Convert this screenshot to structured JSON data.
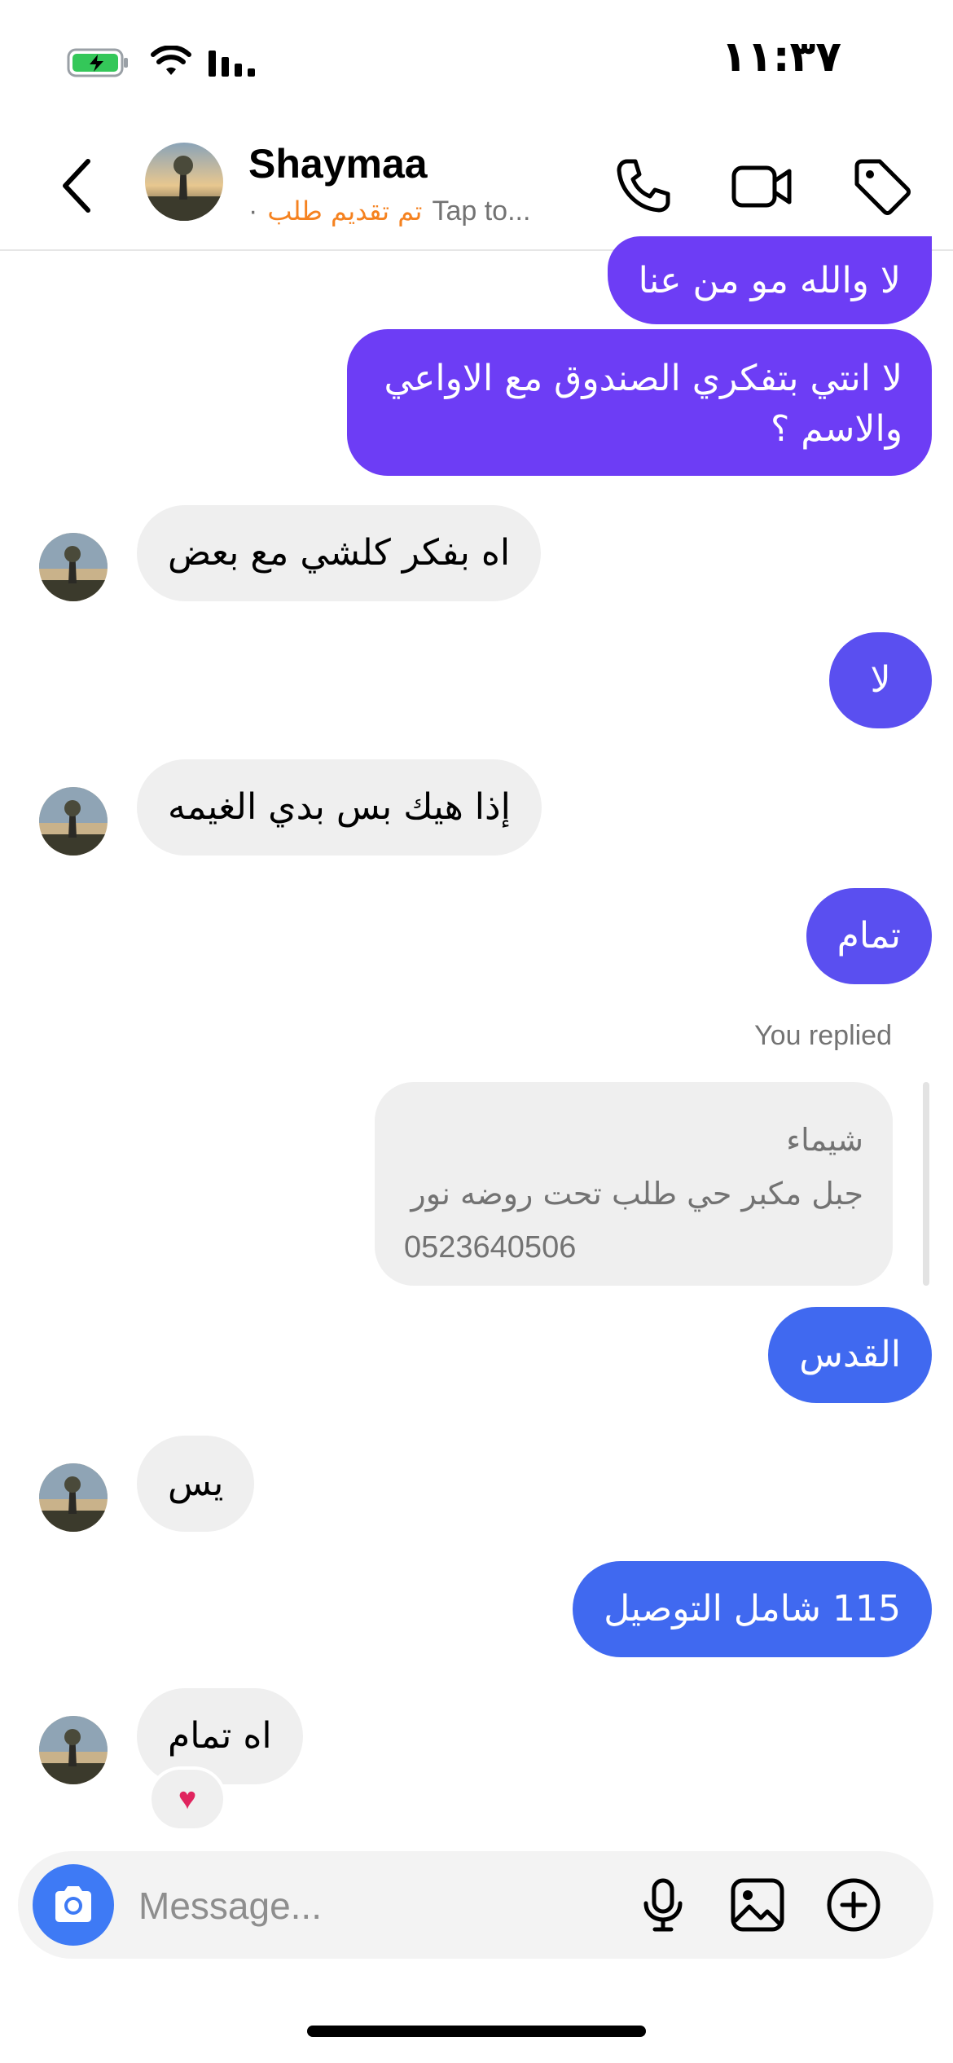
{
  "status_bar": {
    "time": "١١:٣٧",
    "battery_level": 0.85
  },
  "header": {
    "contact_name": "Shaymaa",
    "subtitle_separator": "·",
    "subtitle_order": "تم تقديم طلب",
    "subtitle_hint": "Tap to..."
  },
  "messages": [
    {
      "side": "out",
      "text": "لا والله مو من عنا"
    },
    {
      "side": "out",
      "text": "لا انتي بتفكري الصندوق مع الاواعي",
      "text2": "والاسم ؟"
    },
    {
      "side": "in",
      "text": "اه بفكر كلشي مع بعض"
    },
    {
      "side": "out",
      "text": "لا"
    },
    {
      "side": "in",
      "text": "إذا هيك بس بدي الغيمه"
    },
    {
      "side": "out",
      "text": "تمام"
    },
    {
      "side": "out",
      "text": "القدس"
    },
    {
      "side": "in",
      "text": "يس"
    },
    {
      "side": "out",
      "text": "115 شامل التوصيل"
    },
    {
      "side": "in",
      "text": "اه تمام",
      "reaction": "♥"
    }
  ],
  "reply": {
    "label": "You replied",
    "line1": "شيماء",
    "line2": "جبل مكبر حي طلب تحت روضه نور",
    "line3": "0523640506"
  },
  "composer": {
    "placeholder": "Message..."
  },
  "colors": {
    "outgoing_purple": "#6d3df5",
    "outgoing_violet": "#5a4ff0",
    "outgoing_blue": "#4069f0",
    "incoming": "#efefef",
    "order_status": "#f58220",
    "camera_button": "#3e7af5"
  },
  "icons": [
    "battery-icon",
    "wifi-icon",
    "signal-icon",
    "back-icon",
    "phone-icon",
    "video-icon",
    "tag-icon",
    "camera-icon",
    "mic-icon",
    "gallery-icon",
    "plus-icon",
    "heart-icon"
  ]
}
